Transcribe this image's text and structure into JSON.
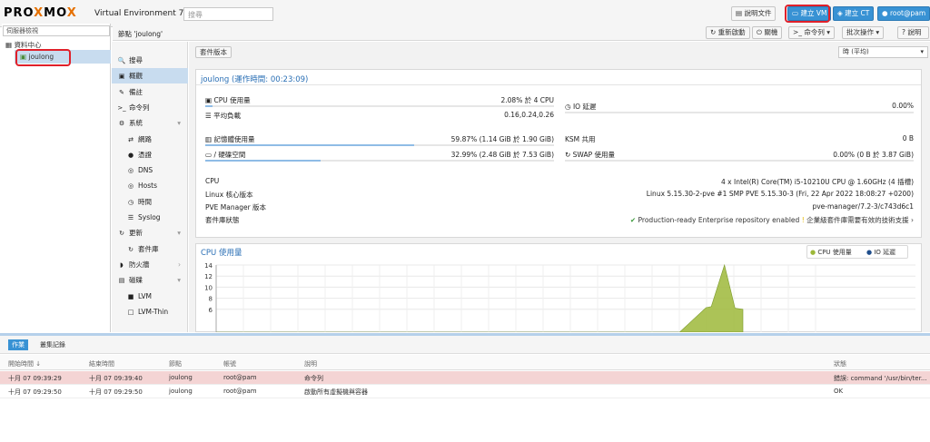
{
  "app": {
    "logo_a": "PRO",
    "logo_x": "X",
    "logo_b": "MO",
    "logo_x2": "X",
    "version": "Virtual Environment 7.2-3",
    "search_placeholder": "搜尋"
  },
  "topbar": {
    "docs": "說明文件",
    "create_vm": "建立 VM",
    "create_ct": "建立 CT",
    "user": "root@pam"
  },
  "tree": {
    "view": "伺服器檢視",
    "datacenter": "資料中心",
    "node": "joulong"
  },
  "node_header": {
    "title": "節點 'joulong'",
    "reboot": "重新啟動",
    "shutdown": "關機",
    "shell": "命令列",
    "bulk": "批次操作",
    "help": "說明"
  },
  "menu": [
    {
      "icon": "search-icon",
      "glyph": "🔍",
      "label": "搜尋"
    },
    {
      "icon": "book-icon",
      "glyph": "▣",
      "label": "概觀",
      "selected": true
    },
    {
      "icon": "notes-icon",
      "glyph": "✎",
      "label": "備註"
    },
    {
      "icon": "terminal-icon",
      "glyph": ">_",
      "label": "命令列"
    },
    {
      "icon": "gears-icon",
      "glyph": "⚙",
      "label": "系統",
      "expand": true
    },
    {
      "icon": "network-icon",
      "glyph": "⇄",
      "label": "網路",
      "sub": true
    },
    {
      "icon": "certificate-icon",
      "glyph": "●",
      "label": "憑證",
      "sub": true
    },
    {
      "icon": "globe-icon",
      "glyph": "◎",
      "label": "DNS",
      "sub": true
    },
    {
      "icon": "globe-icon",
      "glyph": "◎",
      "label": "Hosts",
      "sub": true
    },
    {
      "icon": "clock-icon",
      "glyph": "◷",
      "label": "時間",
      "sub": true
    },
    {
      "icon": "list-icon",
      "glyph": "☰",
      "label": "Syslog",
      "sub": true
    },
    {
      "icon": "refresh-icon",
      "glyph": "↻",
      "label": "更新",
      "expand": true
    },
    {
      "icon": "refresh-icon",
      "glyph": "↻",
      "label": "套件庫",
      "sub": true
    },
    {
      "icon": "shield-icon",
      "glyph": "◗",
      "label": "防火牆",
      "expand_right": true
    },
    {
      "icon": "hdd-icon",
      "glyph": "▤",
      "label": "磁碟",
      "expand": true
    },
    {
      "icon": "square-icon",
      "glyph": "■",
      "label": "LVM",
      "sub": true
    },
    {
      "icon": "square-icon",
      "glyph": "□",
      "label": "LVM-Thin",
      "sub": true
    }
  ],
  "content": {
    "package_versions": "套件版本",
    "timeframe": "時 (平均)",
    "summary_title": "joulong (運作時間: 00:23:09)",
    "cpu_usage_label": "CPU 使用量",
    "cpu_usage_value": "2.08% 於 4 CPU",
    "cpu_usage_fraction": 0.0208,
    "load_label": "平均負載",
    "load_value": "0.16,0.24,0.26",
    "io_label": "IO 延遲",
    "io_value": "0.00%",
    "mem_label": "記憶體使用量",
    "mem_value": "59.87% (1.14 GiB 於 1.90 GiB)",
    "mem_fraction": 0.5987,
    "ksm_label": "KSM 共用",
    "ksm_value": "0 B",
    "disk_label": "/ 硬碟空間",
    "disk_value": "32.99% (2.48 GiB 於 7.53 GiB)",
    "disk_fraction": 0.3299,
    "swap_label": "SWAP 使用量",
    "swap_value": "0.00% (0 B 於 3.87 GiB)",
    "cpu_label": "CPU",
    "cpu_value": "4 x Intel(R) Core(TM) i5-10210U CPU @ 1.60GHz (4 插槽)",
    "kernel_label": "Linux 核心版本",
    "kernel_value": "Linux 5.15.30-2-pve #1 SMP PVE 5.15.30-3 (Fri, 22 Apr 2022 18:08:27 +0200)",
    "pve_label": "PVE Manager 版本",
    "pve_value": "pve-manager/7.2-3/c743d6c1",
    "repo_label": "套件庫狀態",
    "repo_ok": "Production-ready Enterprise repository enabled",
    "repo_warn": "企業級套件庫需要有效的技術支援"
  },
  "chart_data": {
    "type": "area",
    "title": "CPU 使用量",
    "series": [
      {
        "name": "CPU 使用量",
        "color": "#9db83a"
      },
      {
        "name": "IO 延遲",
        "color": "#1f4e8c"
      }
    ],
    "y_ticks": [
      14,
      12,
      10,
      8,
      6
    ],
    "ylim": [
      5,
      14
    ],
    "points": [
      [
        0.0,
        0
      ],
      [
        0.86,
        0
      ],
      [
        0.87,
        1.0
      ],
      [
        0.93,
        6.3
      ],
      [
        0.94,
        6.5
      ],
      [
        0.965,
        14
      ],
      [
        0.985,
        6.2
      ],
      [
        1.0,
        6.0
      ]
    ],
    "grid": true
  },
  "tasks": {
    "tabs": [
      "作業",
      "叢集記錄"
    ],
    "headers": [
      "開始時間 ↓",
      "結束時間",
      "節點",
      "帳號",
      "說明",
      "狀態"
    ],
    "rows": [
      {
        "start": "十月 07 09:39:29",
        "end": "十月 07 09:39:40",
        "node": "joulong",
        "user": "root@pam",
        "desc": "命令列",
        "status": "錯誤: command '/usr/bin/ter...",
        "error": true
      },
      {
        "start": "十月 07 09:29:50",
        "end": "十月 07 09:29:50",
        "node": "joulong",
        "user": "root@pam",
        "desc": "啟動所有虛擬機與容器",
        "status": "OK",
        "error": false
      }
    ]
  }
}
